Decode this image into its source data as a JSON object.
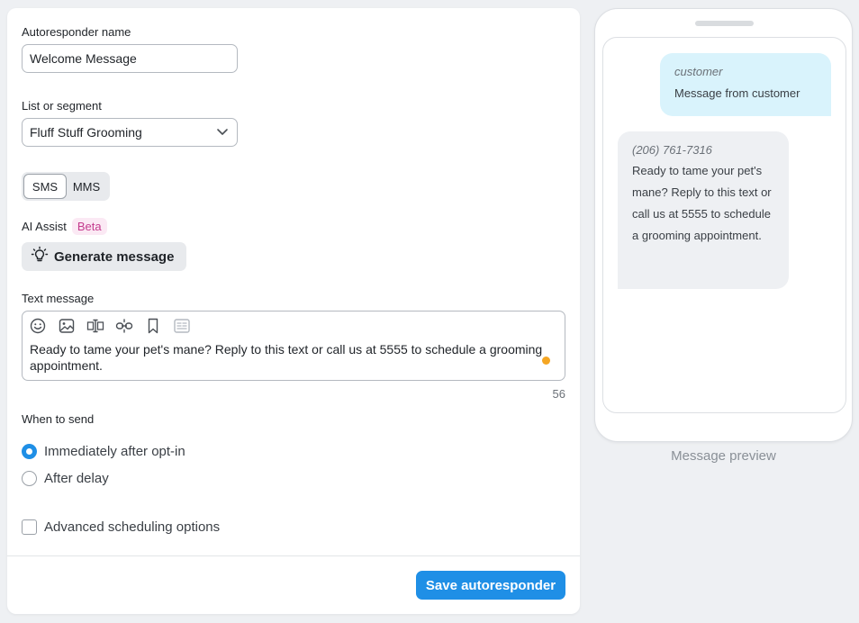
{
  "form": {
    "name_label": "Autoresponder name",
    "name_value": "Welcome Message",
    "list_label": "List or segment",
    "list_value": "Fluff Stuff Grooming",
    "type_toggle": {
      "sms": "SMS",
      "mms": "MMS",
      "selected": "SMS"
    },
    "ai_label": "AI Assist",
    "ai_badge": "Beta",
    "generate_label": "Generate message",
    "text_label": "Text message",
    "text_value": "Ready to tame your pet's mane? Reply to this text or call us at 5555 to schedule a grooming appointment.",
    "char_count": "56",
    "when_label": "When to send",
    "option_immediate": "Immediately after opt-in",
    "option_delay": "After delay",
    "selected_option": "immediate",
    "advanced_label": "Advanced scheduling options",
    "advanced_checked": false,
    "save_label": "Save autoresponder"
  },
  "preview": {
    "customer_name": "customer",
    "customer_message": "Message from customer",
    "sender_number": "(206) 761-7316",
    "reply_message": "Ready to tame your pet's mane? Reply to this text or call us at 5555 to schedule a grooming appointment.",
    "label": "Message preview"
  },
  "colors": {
    "accent": "#1f8fe6",
    "beta_bg": "#fbe9f4",
    "beta_text": "#c43b8d",
    "outgoing_bubble": "#d9f3fc",
    "incoming_bubble": "#eef0f3",
    "status_dot": "#f5a623"
  }
}
